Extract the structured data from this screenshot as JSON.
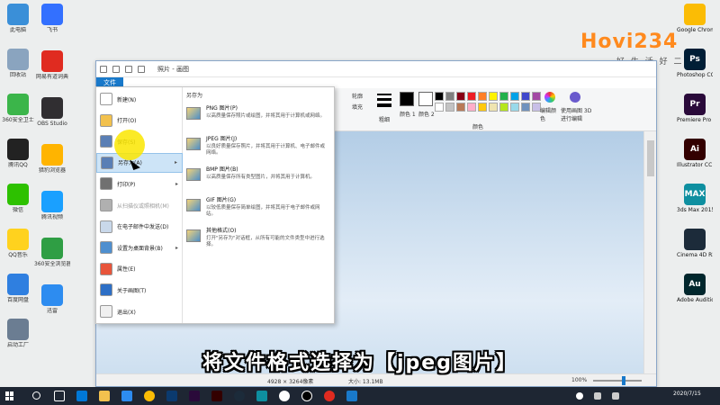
{
  "desktop": {
    "left_icons": [
      {
        "label": "此电脑",
        "color": "#3a8fd8",
        "icon": "computer-icon"
      },
      {
        "label": "回收站",
        "color": "#8aa4bf",
        "icon": "recycle-bin-icon"
      },
      {
        "label": "360安全卫士",
        "color": "#3bb54a",
        "icon": "shield-icon"
      },
      {
        "label": "腾讯QQ",
        "color": "#222222",
        "icon": "penguin-icon"
      },
      {
        "label": "微信",
        "color": "#2dc100",
        "icon": "chat-icon"
      },
      {
        "label": "QQ音乐",
        "color": "#ffd21e",
        "icon": "music-icon"
      },
      {
        "label": "百度网盘",
        "color": "#2f7fe0",
        "icon": "cloud-icon"
      },
      {
        "label": "启动工厂",
        "color": "#6b7d92",
        "icon": "app-icon"
      }
    ],
    "left_icons_col2": [
      {
        "label": "飞书",
        "color": "#3370ff",
        "icon": "paper-plane-icon"
      },
      {
        "label": "网易有道词典",
        "color": "#e02b20",
        "icon": "dictionary-icon"
      },
      {
        "label": "OBS Studio",
        "color": "#302e31",
        "icon": "record-icon"
      },
      {
        "label": "猎豹浏览器",
        "color": "#ffb400",
        "icon": "browser-icon"
      },
      {
        "label": "腾讯视频",
        "color": "#1aa0ff",
        "icon": "video-icon"
      },
      {
        "label": "360安全浏览器",
        "color": "#2f9e44",
        "icon": "globe-icon"
      },
      {
        "label": "迅雷",
        "color": "#2d8cf0",
        "icon": "download-icon"
      }
    ],
    "right_icons": [
      {
        "label": "Google Chrome",
        "short": "",
        "color": "#fbbc05",
        "icon": "chrome-icon"
      },
      {
        "label": "Photoshop CC 2017",
        "short": "Ps",
        "color": "#001e36",
        "icon": "photoshop-icon"
      },
      {
        "label": "Premiere Pro CC 2018",
        "short": "Pr",
        "color": "#2a0a3a",
        "icon": "premiere-icon"
      },
      {
        "label": "Illustrator CC 2017",
        "short": "Ai",
        "color": "#330000",
        "icon": "illustrator-icon"
      },
      {
        "label": "3ds Max 2015",
        "short": "MAX",
        "color": "#0e8fa0",
        "icon": "3dsmax-icon"
      },
      {
        "label": "Cinema 4D R20",
        "short": "",
        "color": "#1c2b3a",
        "icon": "cinema4d-icon"
      },
      {
        "label": "Adobe Audition ...",
        "short": "Au",
        "color": "#00262c",
        "icon": "audition-icon"
      }
    ],
    "logo_brand": "Hovi234",
    "logo_slogan": "好 生 活 好 二 三 四"
  },
  "window": {
    "title": "照片 - 画图",
    "file_tab": "文件"
  },
  "ribbon": {
    "outline_label": "轮廓",
    "fill_label": "填充",
    "size_label": "粗细",
    "color1_label": "颜色 1",
    "color2_label": "颜色 2",
    "edit_colors_label": "编辑颜色",
    "paint3d_label": "使用画图 3D 进行编辑",
    "colors_group": "颜色",
    "palette": [
      "#000000",
      "#7f7f7f",
      "#880015",
      "#ed1c24",
      "#ff7f27",
      "#fff200",
      "#22b14c",
      "#00a2e8",
      "#3f48cc",
      "#a349a4",
      "#ffffff",
      "#c3c3c3",
      "#b97a57",
      "#ffaec9",
      "#ffc90e",
      "#efe4b0",
      "#b5e61d",
      "#99d9ea",
      "#7092be",
      "#c8bfe7"
    ]
  },
  "file_menu": {
    "items": [
      {
        "label": "新建(N)",
        "icon": "new-file-icon",
        "color": "#ffffff",
        "arrow": ""
      },
      {
        "label": "打开(O)",
        "icon": "open-folder-icon",
        "color": "#f2c14e",
        "arrow": ""
      },
      {
        "label": "保存(S)",
        "icon": "save-icon",
        "color": "#5a7fb5",
        "arrow": ""
      },
      {
        "label": "另存为(A)",
        "icon": "save-as-icon",
        "color": "#5a7fb5",
        "arrow": "▸"
      },
      {
        "label": "打印(P)",
        "icon": "printer-icon",
        "color": "#707070",
        "arrow": "▸"
      },
      {
        "label": "从扫描仪或照相机(M)",
        "icon": "scanner-icon",
        "color": "#b0b0b0",
        "arrow": ""
      },
      {
        "label": "在电子邮件中发送(D)",
        "icon": "email-icon",
        "color": "#c9d8ea",
        "arrow": ""
      },
      {
        "label": "设置为桌面背景(B)",
        "icon": "desktop-background-icon",
        "color": "#4f8fcf",
        "arrow": "▸"
      },
      {
        "label": "属性(E)",
        "icon": "checkmark-icon",
        "color": "#e8553b",
        "arrow": ""
      },
      {
        "label": "关于画图(T)",
        "icon": "info-icon",
        "color": "#2d6fc6",
        "arrow": ""
      },
      {
        "label": "退出(X)",
        "icon": "exit-icon",
        "color": "#f0f0f0",
        "arrow": ""
      }
    ],
    "submenu_heading": "另存为",
    "submenu": [
      {
        "title": "PNG 图片(P)",
        "desc": "以高质量保存照片或绘图，并将其用于计算机或网络。"
      },
      {
        "title": "JPEG 图片(J)",
        "desc": "以良好质量保存照片，并将其用于计算机、电子邮件或网络。"
      },
      {
        "title": "BMP 图片(B)",
        "desc": "以高质量保存所有类型图片，并将其用于计算机。"
      },
      {
        "title": "GIF 图片(G)",
        "desc": "以较低质量保存简单绘图，并将其用于电子邮件或网站。"
      },
      {
        "title": "其他格式(O)",
        "desc": "打开\"另存为\"对话框，从所有可能的文件类型中进行选择。"
      }
    ]
  },
  "statusbar": {
    "dimensions": "4928 × 3264像素",
    "filesize": "大小: 13.1MB",
    "zoom": "100%"
  },
  "subtitle": "将文件格式选择为【jpeg图片】",
  "taskbar": {
    "date": "2020/7/15"
  }
}
